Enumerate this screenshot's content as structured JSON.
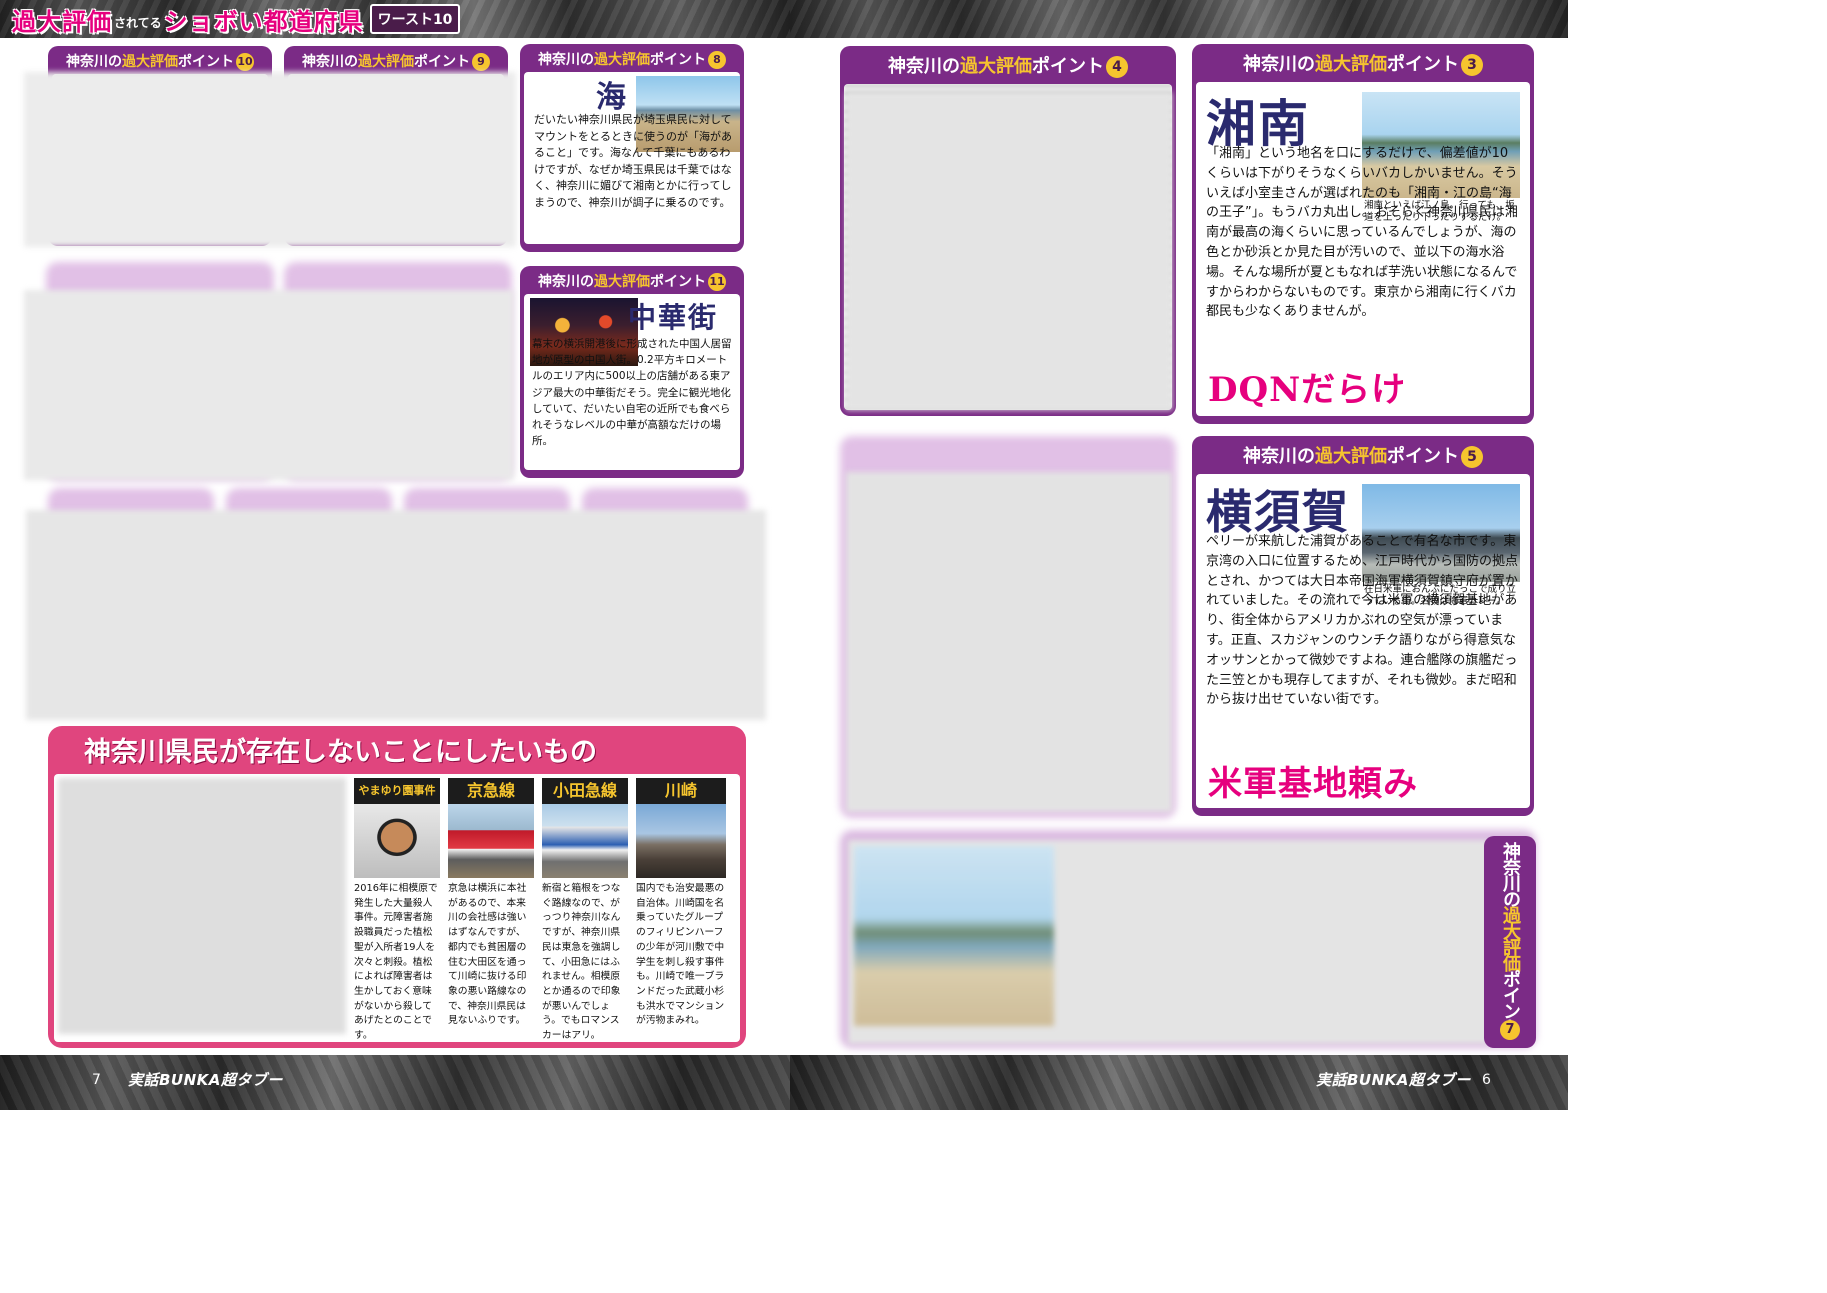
{
  "header": {
    "title_part1": "過大評価",
    "title_small": "されてる",
    "title_part2": "ショボい都道府県",
    "worst_badge": "ワースト10"
  },
  "footer": {
    "left_page_number": "7",
    "right_page_number": "6",
    "logo": "実話BUNKA超タブー"
  },
  "left_page": {
    "point_8": {
      "head_prefix": "神奈川の",
      "head_mid": "過大評価",
      "head_suffix": "ポイント",
      "number": "8",
      "keyword": "海",
      "body": "だいたい神奈川県民が埼玉県民に対してマウントをとるときに使うのが「海があること」です。海なんて千葉にもあるわけですが、なぜか埼玉県民は千葉ではなく、神奈川に媚びて湘南とかに行ってしまうので、神奈川が調子に乗るのです。"
    },
    "point_9": {
      "head_prefix": "神奈川の",
      "head_mid": "過大評価",
      "head_suffix": "ポイント",
      "number": "9"
    },
    "point_10": {
      "head_prefix": "神奈川の",
      "head_mid": "過大評価",
      "head_suffix": "ポイント",
      "number": "10"
    },
    "point_11": {
      "head_prefix": "神奈川の",
      "head_mid": "過大評価",
      "head_suffix": "ポイント",
      "number": "11",
      "keyword": "中華街",
      "body": "幕末の横浜開港後に形成された中国人居留地が原型の中国人街。0.2平方キロメートルのエリア内に500以上の店舗がある東アジア最大の中華街だそう。完全に観光地化していて、だいたい自宅の近所でも食べられそうなレベルの中華が高額なだけの場所。"
    },
    "bottom_section": {
      "title": "神奈川県民が存在しないことにしたいもの",
      "columns": [
        {
          "head": "やまゆり園事件",
          "photo": "person-photo",
          "text": "2016年に相模原で発生した大量殺人事件。元障害者施設職員だった植松聖が入所者19人を次々と刺殺。植松によれば障害者は生かしておく意味がないから殺してあげたとのことです。"
        },
        {
          "head": "京急線",
          "photo": "red-train-photo",
          "text": "京急は横浜に本社があるので、本来川の会社感は強いはずなんですが、都内でも貧困層の住む大田区を通って川崎に抜ける印象の悪い路線なので、神奈川県民は見ないふりです。"
        },
        {
          "head": "小田急線",
          "photo": "blue-train-photo",
          "text": "新宿と箱根をつなぐ路線なので、がっつり神奈川なんですが、神奈川県民は東急を強調して、小田急にはふれません。相模原とか通るので印象が悪いんでしょう。でもロマンスカーはアリ。"
        },
        {
          "head": "川崎",
          "photo": "factory-photo",
          "text": "国内でも治安最悪の自治体。川崎国を名乗っていたグループのフィリピンハーフの少年が河川敷で中学生を刺し殺す事件も。川崎で唯一ブランドだった武蔵小杉も洪水でマンションが汚物まみれ。"
        }
      ]
    }
  },
  "right_page": {
    "point_3": {
      "head_prefix": "神奈川の",
      "head_mid": "過大評価",
      "head_suffix": "ポイント",
      "number": "3",
      "keyword": "湘南",
      "caption": "湘南といえば江ノ島。行っても、坂道を上ったり下ったりするだけ。",
      "body": "「湘南」という地名を口にするだけで、偏差値が10くらいは下がりそうなくらいバカしかいません。そういえば小室圭さんが選ばれたのも「湘南・江の島“海の王子”」。もうバカ丸出し。おそらく神奈川県民は湘南が最高の海くらいに思っているんでしょうが、海の色とか砂浜とか見た目が汚いので、並以下の海水浴場。そんな場所が夏ともなれば芋洗い状態になるんですからわからないものです。東京から湘南に行くバカ都民も少なくありませんが。",
      "slogan": "DQNだらけ"
    },
    "point_4": {
      "head_prefix": "神奈川の",
      "head_mid": "過大評価",
      "head_suffix": "ポイント",
      "number": "4"
    },
    "point_5": {
      "head_prefix": "神奈川の",
      "head_mid": "過大評価",
      "head_suffix": "ポイント",
      "number": "5",
      "keyword": "横須賀",
      "caption": "在日米軍におんぶにだっこで成り立っている街。名物は海軍カレー。",
      "body": "ペリーが来航した浦賀があることで有名な市です。東京湾の入口に位置するため、江戸時代から国防の拠点とされ、かつては大日本帝国海軍横須賀鎮守府が置かれていました。その流れで今は米軍の横須賀基地があり、街全体からアメリカかぶれの空気が漂っています。正直、スカジャンのウンチク語りながら得意気なオッサンとかって微妙ですよね。連合艦隊の旗艦だった三笠とかも現存してますが、それも微妙。まだ昭和から抜け出せていない街です。",
      "slogan": "米軍基地頼み"
    },
    "point_7": {
      "head_prefix": "神奈川の",
      "head_mid": "過大評価",
      "head_suffix": "ポイント",
      "number": "7"
    }
  }
}
